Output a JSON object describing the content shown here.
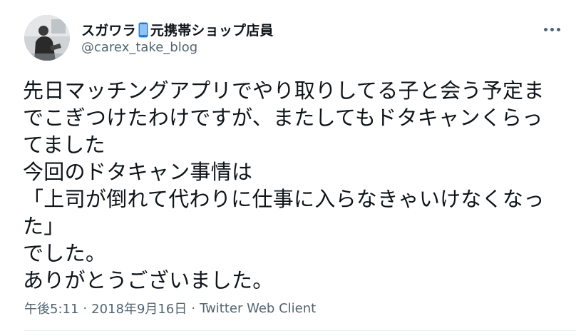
{
  "tweet": {
    "display_name_prefix": "スガワラ",
    "display_name_suffix": "元携帯ショップ店員",
    "handle": "@carex_take_blog",
    "text": "先日マッチングアプリでやり取りしてる子と会う予定までこぎつけたわけですが、またしてもドタキャンくらってました\n今回のドタキャン事情は\n「上司が倒れて代わりに仕事に入らなきゃいけなくなった」\nでした。\nありがとうございました。",
    "time": "午後5:11",
    "date": "2018年9月16日",
    "separator": "·",
    "client": "Twitter Web Client"
  },
  "icons": {
    "name_emoji": "mobile-phone-icon",
    "more": "more-horizontal-icon"
  },
  "colors": {
    "primary_text": "#0f1419",
    "secondary_text": "#536471",
    "divider": "#e6ecf0",
    "phone_blue": "#2d7fd3"
  }
}
